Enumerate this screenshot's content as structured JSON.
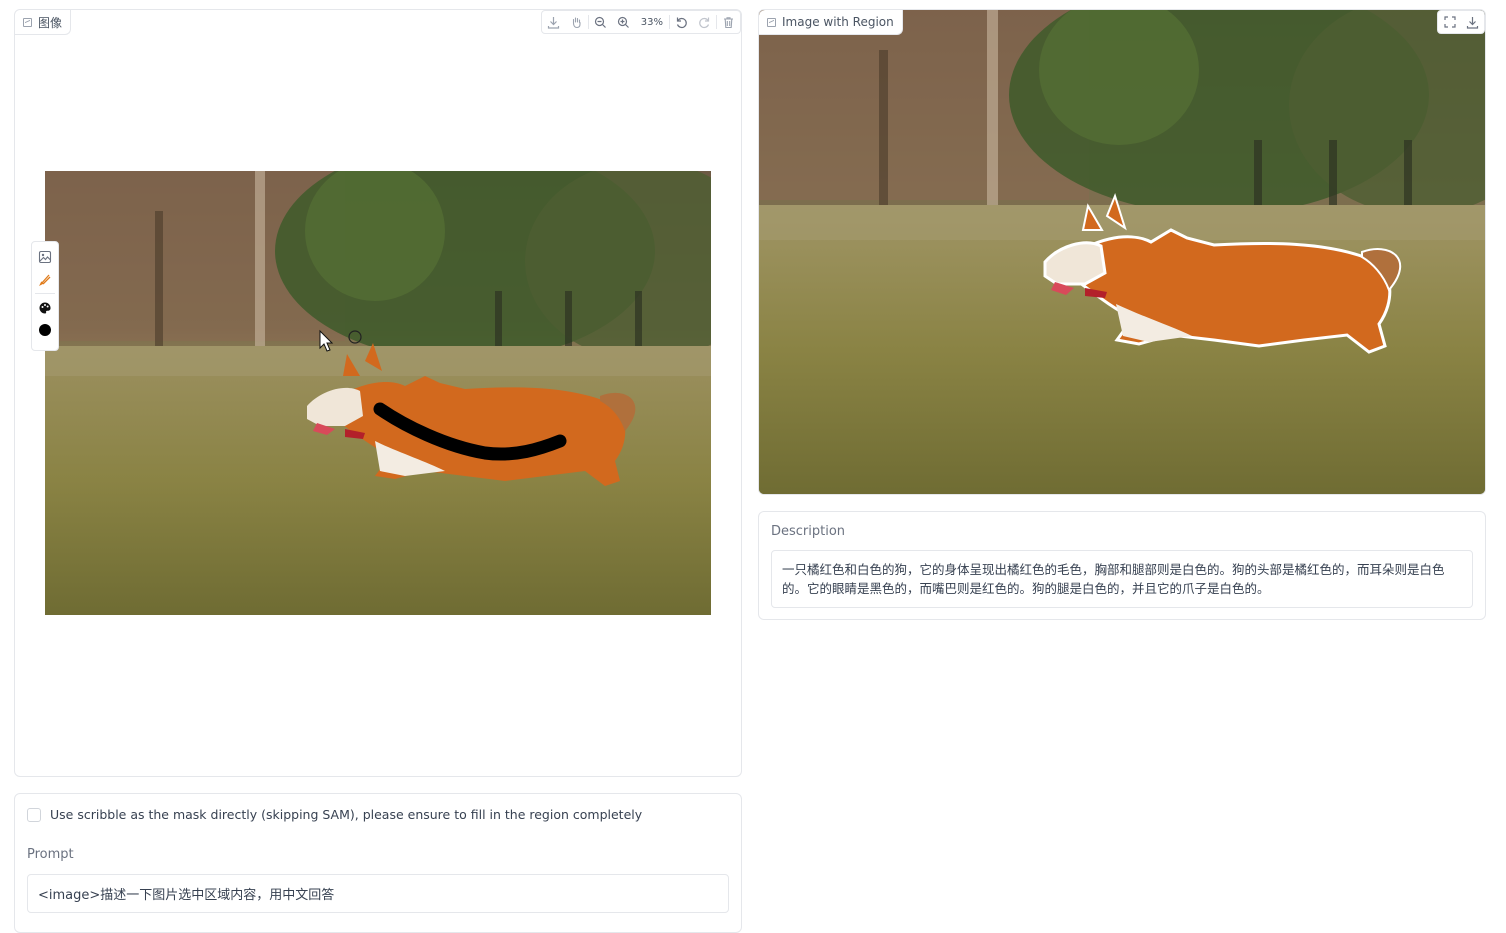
{
  "left_panel": {
    "label": "图像",
    "toolbar": {
      "zoom": "33%"
    },
    "canvas_image": "running corgi on grass with black scribble stroke"
  },
  "right_panel": {
    "label": "Image with Region"
  },
  "description": {
    "label": "Description",
    "text": "一只橘红色和白色的狗，它的身体呈现出橘红色的毛色，胸部和腿部则是白色的。狗的头部是橘红色的，而耳朵则是白色的。它的眼睛是黑色的，而嘴巴则是红色的。狗的腿是白色的，并且它的爪子是白色的。"
  },
  "options": {
    "scribble_checkbox_label": "Use scribble as the mask directly (skipping SAM), please ensure to fill in the region completely",
    "scribble_checked": false
  },
  "prompt": {
    "label": "Prompt",
    "value": "<image>描述一下图片选中区域内容，用中文回答"
  },
  "colors": {
    "border": "#e5e7eb",
    "brush": "#000000",
    "grass": "#8a8a45",
    "forest": "#3f5a2c",
    "dog": "#d2691e"
  }
}
